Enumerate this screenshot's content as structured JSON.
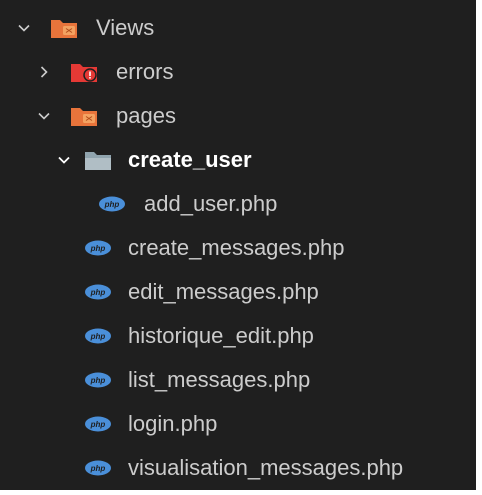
{
  "explorer": {
    "items": [
      {
        "label": "Views",
        "kind": "folder",
        "icon": "views-folder-icon",
        "expanded": true
      },
      {
        "label": "errors",
        "kind": "folder",
        "icon": "error-folder-icon",
        "expanded": false
      },
      {
        "label": "pages",
        "kind": "folder",
        "icon": "views-folder-icon",
        "expanded": true
      },
      {
        "label": "create_user",
        "kind": "folder",
        "icon": "folder-icon",
        "expanded": true
      },
      {
        "label": "add_user.php",
        "kind": "file",
        "icon": "php-file-icon"
      },
      {
        "label": "create_messages.php",
        "kind": "file",
        "icon": "php-file-icon"
      },
      {
        "label": "edit_messages.php",
        "kind": "file",
        "icon": "php-file-icon"
      },
      {
        "label": "historique_edit.php",
        "kind": "file",
        "icon": "php-file-icon"
      },
      {
        "label": "list_messages.php",
        "kind": "file",
        "icon": "php-file-icon"
      },
      {
        "label": "login.php",
        "kind": "file",
        "icon": "php-file-icon"
      },
      {
        "label": "visualisation_messages.php",
        "kind": "file",
        "icon": "php-file-icon"
      }
    ]
  },
  "colors": {
    "background": "#1f1f1f",
    "folder_orange": "#e8743b",
    "folder_gray": "#90a4ae",
    "error_red": "#e53935",
    "php_blue": "#4a8fd9",
    "text": "#cccccc"
  }
}
